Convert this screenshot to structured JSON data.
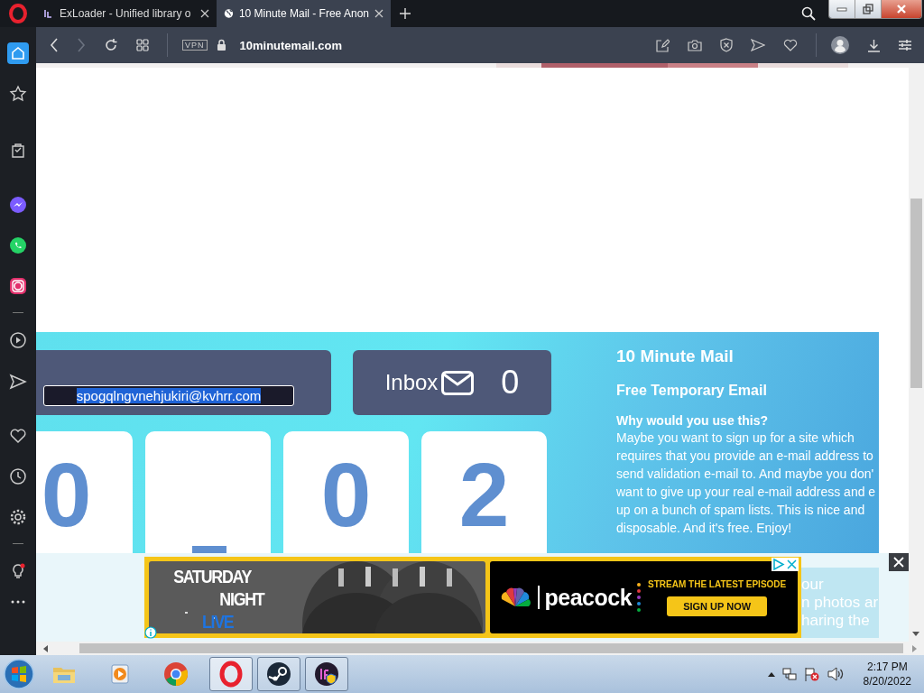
{
  "browser": {
    "tabs": [
      {
        "title": "ExLoader - Unified library o",
        "selected": false
      },
      {
        "title": "10 Minute Mail - Free Anon",
        "selected": true
      }
    ],
    "vpn_badge": "VPN",
    "address": "10minutemail.com"
  },
  "sidebar": {
    "items": [
      {
        "selected": true
      },
      {
        "selected": false
      },
      {
        "selected": false
      },
      {
        "selected": false
      },
      {
        "selected": false
      },
      {
        "selected": false
      },
      {
        "selected": false
      },
      {
        "selected": false
      },
      {
        "selected": false
      },
      {
        "selected": false
      },
      {
        "selected": false
      },
      {
        "selected": false
      },
      {
        "selected": false
      }
    ]
  },
  "page": {
    "email": "spogqlngvnehjukiri@kvhrr.com",
    "inbox_label": "Inbox",
    "inbox_count": "0",
    "timer": [
      {
        "kind": "digit",
        "text": "0"
      },
      {
        "kind": "fragment"
      },
      {
        "kind": "digit",
        "text": "0"
      },
      {
        "kind": "digit",
        "text": "2"
      }
    ],
    "title": "10 Minute Mail",
    "subtitle": "Free Temporary Email",
    "question": "Why would you use this?",
    "answer_lines": [
      "Maybe you want to sign up for a site which",
      "requires that you provide an e-mail address to",
      "send validation e-mail to. And maybe you don'",
      "want to give up your real e-mail address and e",
      "up on a bunch of spam lists. This is nice and",
      "disposable. And it's free. Enjoy!"
    ]
  },
  "ad": {
    "show_lines": [
      "SATURDAY",
      "NIGHT",
      "LIVE"
    ],
    "brand": "peacock",
    "tagline": "STREAM THE LATEST EPISODE",
    "cta": "SIGN UP NOW",
    "behind_text": [
      "our",
      "n photos ar",
      "haring the"
    ]
  },
  "taskbar": {
    "apps": [
      {
        "running": false,
        "selected": false
      },
      {
        "running": false,
        "selected": false
      },
      {
        "running": false,
        "selected": false
      },
      {
        "running": true,
        "selected": true
      },
      {
        "running": true,
        "selected": false
      },
      {
        "running": true,
        "selected": false
      }
    ],
    "time": "2:17 PM",
    "date": "8/20/2022"
  }
}
